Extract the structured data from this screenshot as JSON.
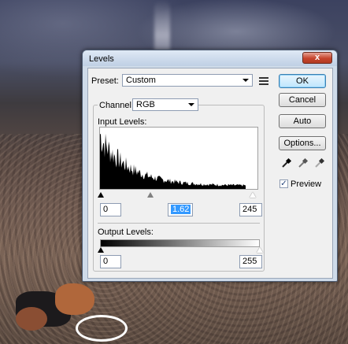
{
  "window": {
    "title": "Levels",
    "close_label": "x"
  },
  "preset": {
    "label": "Preset:",
    "value": "Custom"
  },
  "channel": {
    "label": "Channel:",
    "value": "RGB"
  },
  "input_levels": {
    "label": "Input Levels:",
    "black": "0",
    "gamma": "1.62",
    "white": "245"
  },
  "output_levels": {
    "label": "Output Levels:",
    "black": "0",
    "white": "255"
  },
  "buttons": {
    "ok": "OK",
    "cancel": "Cancel",
    "auto": "Auto",
    "options": "Options..."
  },
  "preview": {
    "label": "Preview",
    "checked": true
  },
  "icons": {
    "preset_menu": "list-menu-icon",
    "black_eyedropper": "black-eyedropper-icon",
    "gray_eyedropper": "gray-eyedropper-icon",
    "white_eyedropper": "white-eyedropper-icon"
  }
}
